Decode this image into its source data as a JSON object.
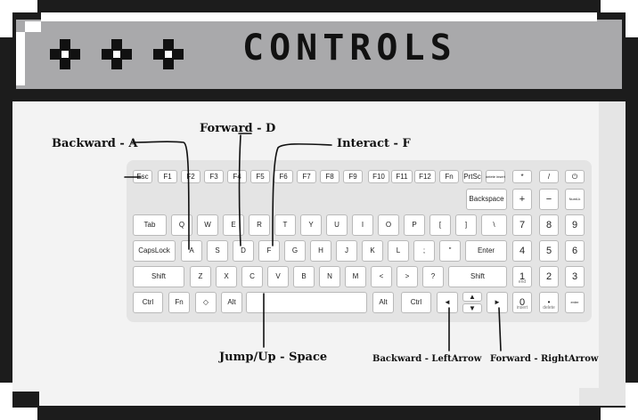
{
  "title": "CONTROLS",
  "callouts": {
    "backward": "Backward - A",
    "forward": "Forward - D",
    "interact": "Interact - F",
    "jump": "Jump/Up - Space",
    "backward_arrow": "Backward - LeftArrow",
    "forward_arrow": "Forward - RightArrow"
  },
  "keys": {
    "esc": "Esc",
    "f1": "F1",
    "f2": "F2",
    "f3": "F3",
    "f4": "F4",
    "f5": "F5",
    "f6": "F6",
    "f7": "F7",
    "f8": "F8",
    "f9": "F9",
    "f10": "F10",
    "f11": "F11",
    "f12": "F12",
    "fn_top": "Fn",
    "prtsc": "PrtSc",
    "delete_insert": "delete insert",
    "backspace": "Backspace",
    "plus": "+",
    "minus": "−",
    "numlk": "NumLk",
    "tab": "Tab",
    "q": "Q",
    "w": "W",
    "e": "E",
    "r": "R",
    "t": "T",
    "y": "Y",
    "u": "U",
    "i": "I",
    "o": "O",
    "p": "P",
    "lbracket": "[",
    "rbracket": "]",
    "backslash": "\\",
    "n7": "7",
    "n8": "8",
    "n9": "9",
    "capslock": "CapsLock",
    "a": "A",
    "s": "S",
    "d": "D",
    "f": "F",
    "g": "G",
    "h": "H",
    "j": "J",
    "k": "K",
    "l": "L",
    "semicolon": ";",
    "quote": "\"",
    "enter": "Enter",
    "n4": "4",
    "n5": "5",
    "n6": "6",
    "lshift": "Shift",
    "z": "Z",
    "x": "X",
    "c": "C",
    "v": "V",
    "b": "B",
    "n": "N",
    "m": "M",
    "comma": "<",
    "period": ">",
    "slash": "?",
    "rshift": "Shift",
    "n1": "1",
    "n2": "2",
    "n3": "3",
    "lctrl": "Ctrl",
    "fn": "Fn",
    "win": "◇",
    "lalt": "Alt",
    "ralt": "Alt",
    "rctrl": "Ctrl",
    "left": "◄",
    "up": "▲",
    "down": "▼",
    "right": "►",
    "n0": "0",
    "ndot": "•",
    "nenter": "enter",
    "star": "*",
    "slash_num": "/",
    "power": "⏻",
    "n1_sub": "end",
    "n0_sub": "insert",
    "ndot_sub": "delete"
  }
}
